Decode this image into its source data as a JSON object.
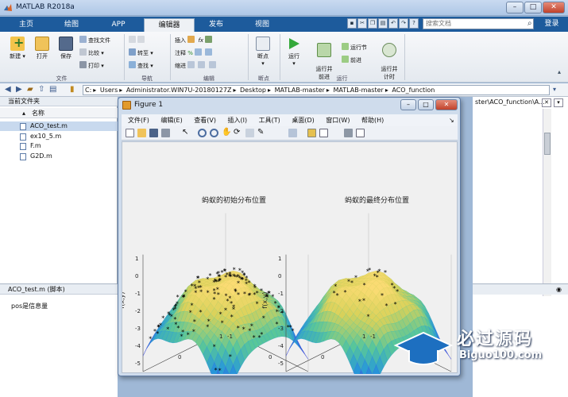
{
  "window": {
    "title": "MATLAB R2018a",
    "min": "–",
    "max": "□",
    "close": "✕"
  },
  "tabs": [
    "主页",
    "绘图",
    "APP",
    "编辑器",
    "发布",
    "视图"
  ],
  "active_tab": "编辑器",
  "search": {
    "placeholder": "搜索文档"
  },
  "login": "登录",
  "ribbon": {
    "file": {
      "new": "新建",
      "open": "打开",
      "save": "保存",
      "find_files": "查找文件",
      "compare": "比较",
      "print": "打印",
      "group": "文件"
    },
    "navigate": {
      "goto": "转至",
      "find": "查找",
      "group": "导航"
    },
    "edit": {
      "insert": "插入",
      "comment": "注释",
      "indent": "缩进",
      "fx": "fx",
      "group": "编辑"
    },
    "breakpoints": {
      "label": "断点",
      "group": "断点"
    },
    "run": {
      "run": "运行",
      "run_advance": "运行并\n前进",
      "run_section": "运行节",
      "advance": "前进",
      "run_time": "运行并\n计时",
      "group": "运行"
    }
  },
  "path": [
    "C:",
    "Users",
    "Administrator.WIN7U-20180127Z",
    "Desktop",
    "MATLAB-master",
    "MATLAB-master",
    "ACO_function"
  ],
  "current_folder": {
    "title": "当前文件夹",
    "col_name": "名称",
    "files": [
      "ACO_test.m",
      "ex10_5.m",
      "F.m",
      "G2D.m"
    ],
    "selected": "ACO_test.m"
  },
  "details": {
    "title": "ACO_test.m  (脚本)",
    "text": "pos是信息量"
  },
  "right_path": "ster\\ACO_function\\A...",
  "figure": {
    "title": "Figure 1",
    "menus": [
      "文件(F)",
      "编辑(E)",
      "查看(V)",
      "插入(I)",
      "工具(T)",
      "桌面(D)",
      "窗口(W)",
      "帮助(H)"
    ],
    "plots": [
      {
        "title": "蚂蚁的初始分布位置",
        "zlabel": "f(x,y)",
        "xlabel": "x",
        "ylabel": "y",
        "zticks": [
          "1",
          "0",
          "-1",
          "-2",
          "-3",
          "-4",
          "-5"
        ],
        "xticks": [
          "-1",
          "0",
          "1"
        ],
        "yticks": [
          "-1",
          "0",
          "1"
        ]
      },
      {
        "title": "蚂蚁的最终分布位置",
        "zlabel": "f(x,y)",
        "xlabel": "x",
        "ylabel": "y",
        "zticks": [
          "1",
          "0",
          "-1",
          "-2",
          "-3",
          "-4",
          "-5"
        ],
        "xticks": [
          "-1",
          "0",
          "1"
        ],
        "yticks": [
          "-1",
          "0",
          "1"
        ]
      }
    ]
  },
  "watermark": {
    "cn": "必过源码",
    "en": "Biguo100.com"
  },
  "colors": {
    "ribbon_tab_bg": "#1d5b9c",
    "surface_top": "#f4d36a",
    "surface_mid": "#5fc7a5",
    "surface_low": "#3f6fd0"
  }
}
